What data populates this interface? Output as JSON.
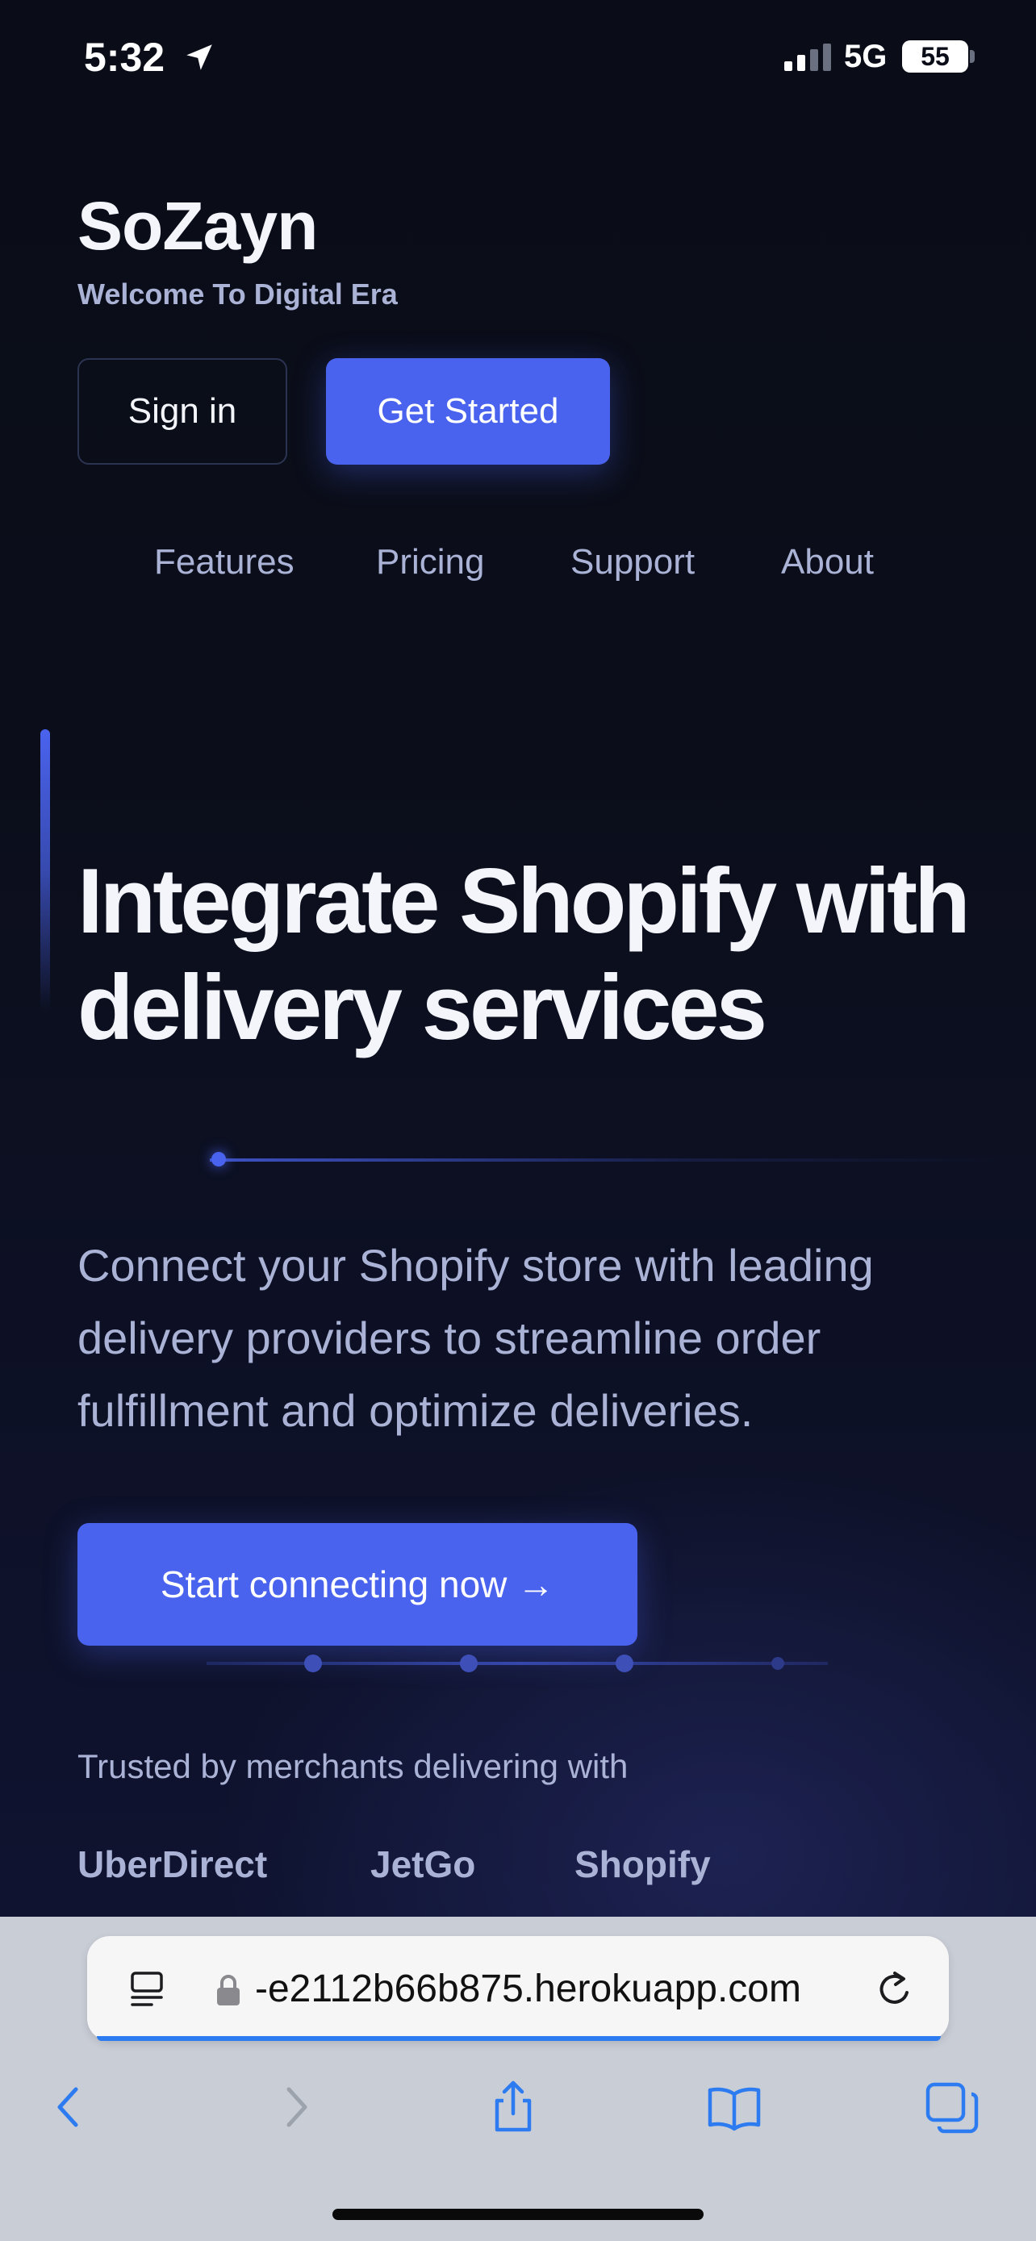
{
  "status_bar": {
    "time": "5:32",
    "network": "5G",
    "battery": "55",
    "icons": [
      "location-arrow-icon",
      "signal-icon",
      "battery-icon"
    ]
  },
  "header": {
    "brand": "SoZayn",
    "tagline": "Welcome To Digital Era",
    "signin_label": "Sign in",
    "getstarted_label": "Get Started"
  },
  "nav": {
    "items": [
      {
        "label": "Features"
      },
      {
        "label": "Pricing"
      },
      {
        "label": "Support"
      },
      {
        "label": "About"
      }
    ]
  },
  "hero": {
    "heading": "Integrate Shopify with delivery services",
    "description": "Connect your Shopify store with leading delivery providers to streamline order fulfillment and optimize deliveries.",
    "cta_label": "Start connecting now →"
  },
  "trusted": {
    "label": "Trusted by merchants delivering with",
    "partners": [
      "UberDirect",
      "JetGo",
      "Shopify"
    ]
  },
  "browser": {
    "url": "-e2112b66b875.herokuapp.com",
    "toolbar_icons": [
      "back-icon",
      "forward-icon",
      "share-icon",
      "bookmarks-icon",
      "tabs-icon"
    ]
  },
  "colors": {
    "background": "#0a0d18",
    "accent": "#4a63ee",
    "text_primary": "#f3f5fb",
    "text_secondary": "#aab3d6",
    "browser_chrome": "#c9cdd6",
    "ios_blue": "#2c7bf0"
  }
}
